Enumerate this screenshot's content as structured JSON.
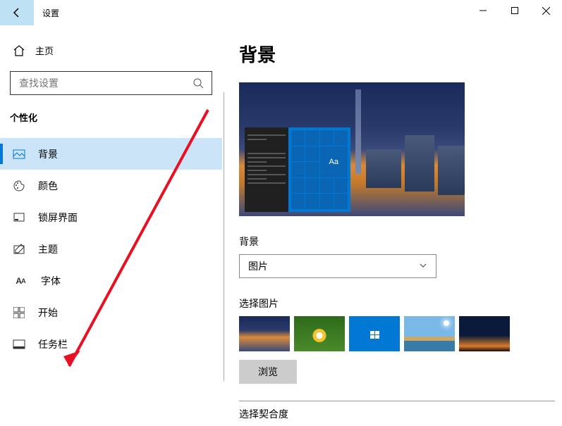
{
  "window": {
    "title": "设置"
  },
  "sidebar": {
    "home_label": "主页",
    "search_placeholder": "查找设置",
    "section_header": "个性化",
    "items": [
      {
        "label": "背景",
        "icon": "picture-icon",
        "active": true
      },
      {
        "label": "颜色",
        "icon": "palette-icon",
        "active": false
      },
      {
        "label": "锁屏界面",
        "icon": "lockscreen-icon",
        "active": false
      },
      {
        "label": "主题",
        "icon": "pencil-icon",
        "active": false
      },
      {
        "label": "字体",
        "icon": "font-icon",
        "active": false
      },
      {
        "label": "开始",
        "icon": "start-icon",
        "active": false
      },
      {
        "label": "任务栏",
        "icon": "taskbar-icon",
        "active": false
      }
    ]
  },
  "content": {
    "page_title": "背景",
    "preview_sample_text": "Aa",
    "bg_section_label": "背景",
    "bg_dropdown_value": "图片",
    "choose_picture_label": "选择图片",
    "browse_button_label": "浏览",
    "fit_label": "选择契合度"
  },
  "annotation": {
    "target_item": "任务栏"
  }
}
